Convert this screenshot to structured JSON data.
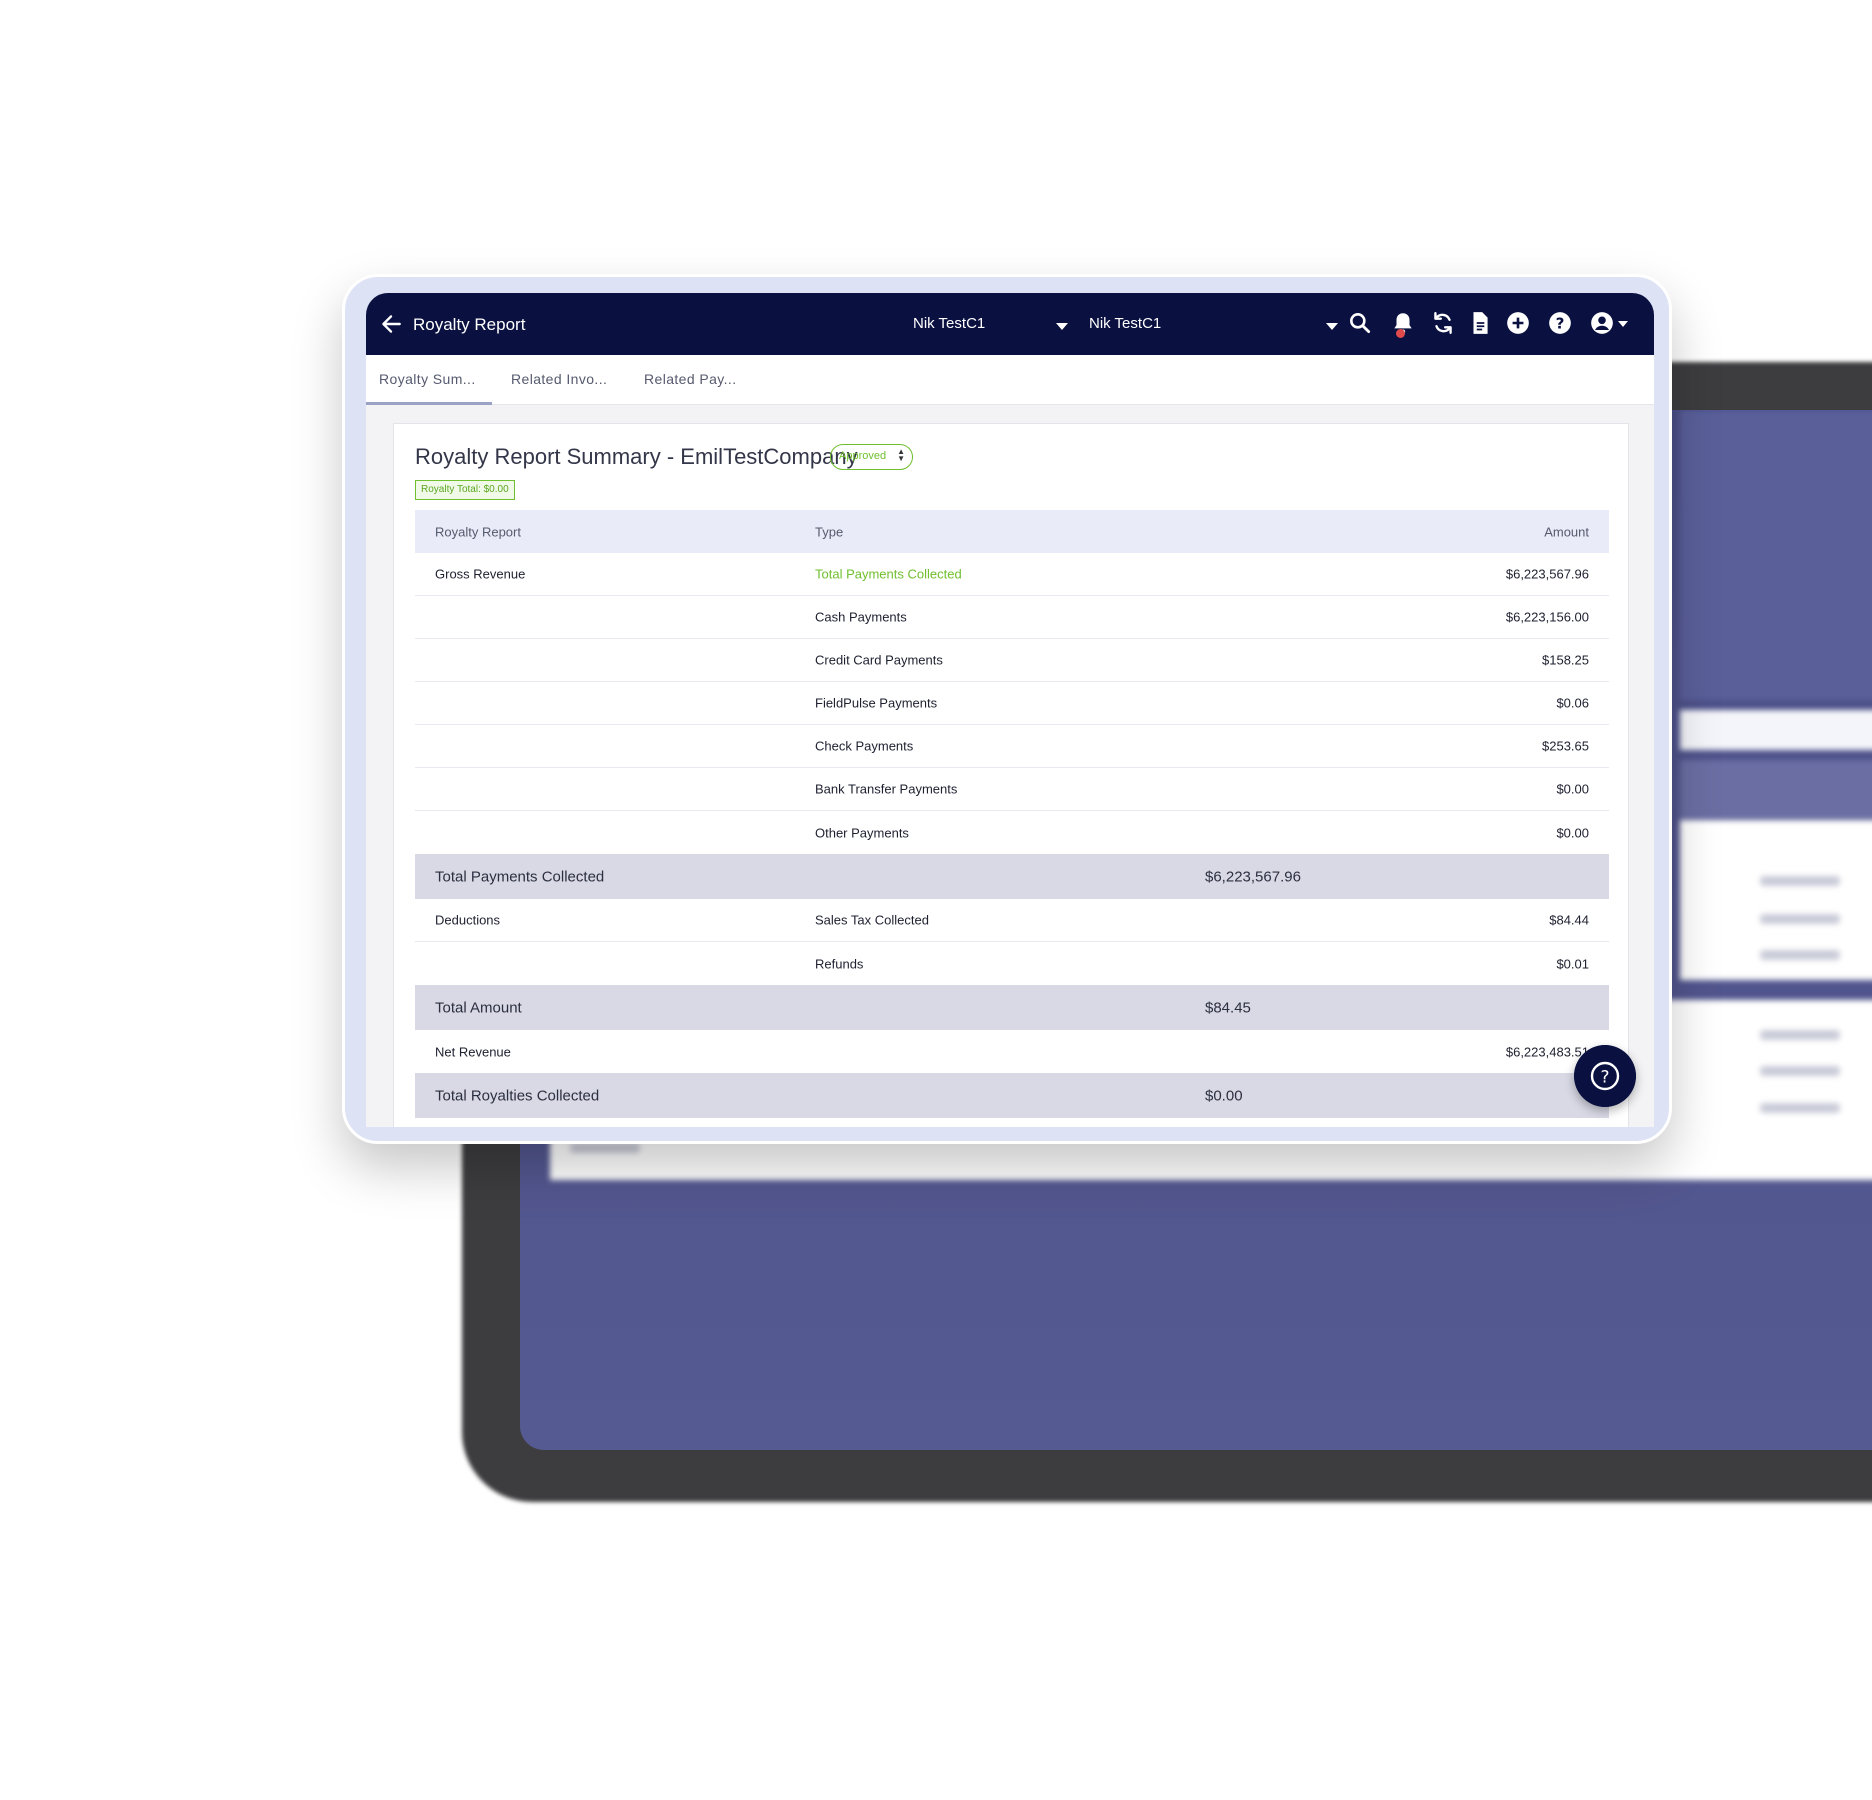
{
  "app": {
    "title": "Royalty Report",
    "company_left": "Nik TestC1",
    "company_right": "Nik TestC1"
  },
  "nav_icons": [
    "search-icon",
    "bell-icon",
    "sync-icon",
    "document-icon",
    "plus-circle-icon",
    "help-icon",
    "user-icon"
  ],
  "tabs": [
    {
      "label": "Royalty Sum..."
    },
    {
      "label": "Related Invo..."
    },
    {
      "label": "Related Pay..."
    }
  ],
  "summary": {
    "title": "Royalty Report Summary - EmilTestCompany",
    "status": "Approved",
    "royalty_total": "Royalty Total: $0.00"
  },
  "table": {
    "headers": {
      "col1": "Royalty Report",
      "col2": "Type",
      "col3": "Amount"
    },
    "rows": [
      {
        "col1": "Gross Revenue",
        "col2": "Total Payments Collected",
        "col3": "$6,223,567.96"
      },
      {
        "col1": "",
        "col2": "Cash Payments",
        "col3": "$6,223,156.00"
      },
      {
        "col1": "",
        "col2": "Credit Card Payments",
        "col3": "$158.25"
      },
      {
        "col1": "",
        "col2": "FieldPulse Payments",
        "col3": "$0.06"
      },
      {
        "col1": "",
        "col2": "Check Payments",
        "col3": "$253.65"
      },
      {
        "col1": "",
        "col2": "Bank Transfer Payments",
        "col3": "$0.00"
      },
      {
        "col1": "",
        "col2": "Other Payments",
        "col3": "$0.00"
      }
    ],
    "total_payments": {
      "label": "Total Payments Collected",
      "value": "$6,223,567.96"
    },
    "deductions": [
      {
        "col1": "Deductions",
        "col2": "Sales Tax Collected",
        "col3": "$84.44"
      },
      {
        "col1": "",
        "col2": "Refunds",
        "col3": "$0.01"
      }
    ],
    "total_amount": {
      "label": "Total Amount",
      "value": "$84.45"
    },
    "net_revenue": {
      "label": "Net Revenue",
      "value": "$6,223,483.51"
    },
    "total_royalties": {
      "label": "Total Royalties Collected",
      "value": "$0.00"
    }
  },
  "colors": {
    "nav": "#0a1141",
    "accent_green": "#6fbf2e",
    "header_row": "#e9ebf8",
    "total_row": "#d8d9e5"
  }
}
